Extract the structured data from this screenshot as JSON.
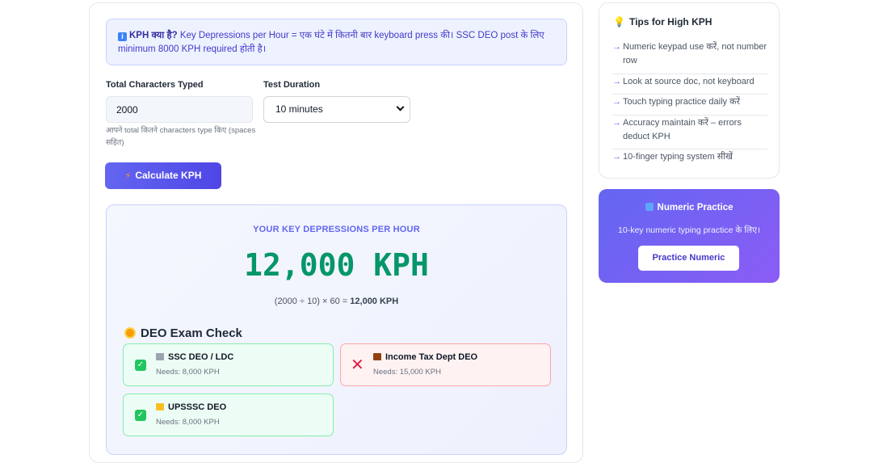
{
  "info": {
    "title": "KPH क्या है?",
    "text": "Key Depressions per Hour = एक घंटे में कितनी बार keyboard press की। SSC DEO post के लिए minimum 8000 KPH required होती है।"
  },
  "form": {
    "chars_label": "Total Characters Typed",
    "chars_value": "2000",
    "chars_hint": "आपने total कितने characters type किए (spaces सहित)",
    "duration_label": "Test Duration",
    "duration_value": "10 minutes",
    "calculate_label": "Calculate KPH"
  },
  "result": {
    "label": "YOUR KEY DEPRESSIONS PER HOUR",
    "value": "12,000 KPH",
    "formula_prefix": "(2000 ÷ 10) × 60 = ",
    "formula_result": "12,000 KPH"
  },
  "exam_check": {
    "title": "DEO Exam Check",
    "exams": [
      {
        "name": "SSC DEO / LDC",
        "needs": "Needs: 8,000 KPH",
        "status": "pass",
        "icon": "bank-icon"
      },
      {
        "name": "Income Tax Dept DEO",
        "needs": "Needs: 15,000 KPH",
        "status": "fail",
        "icon": "briefcase-icon"
      },
      {
        "name": "UPSSSC DEO",
        "needs": "Needs: 8,000 KPH",
        "status": "pass",
        "icon": "folder-icon"
      }
    ]
  },
  "tips": {
    "title": "Tips for High KPH",
    "items": [
      "Numeric keypad use करें, not number row",
      "Look at source doc, not keyboard",
      "Touch typing practice daily करें",
      "Accuracy maintain करें – errors deduct KPH",
      "10-finger typing system सीखें"
    ]
  },
  "promo": {
    "title": "Numeric Practice",
    "subtitle": "10-key numeric typing practice के लिए।",
    "button": "Practice Numeric"
  },
  "colors": {
    "accent": "#6366f1",
    "success": "#059669",
    "danger": "#e11d48"
  }
}
